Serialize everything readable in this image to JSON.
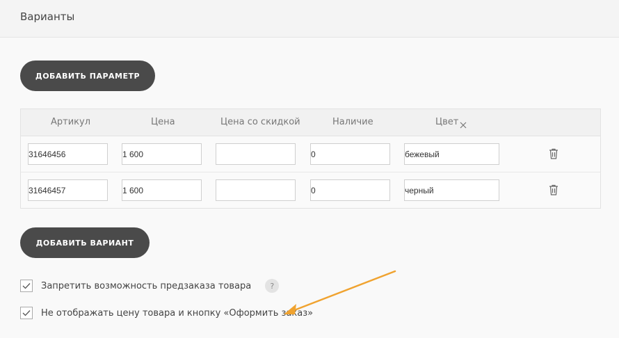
{
  "header": {
    "title": "Варианты"
  },
  "buttons": {
    "add_param": "ДОБАВИТЬ ПАРАМЕТР",
    "add_variant": "ДОБАВИТЬ ВАРИАНТ"
  },
  "table": {
    "columns": [
      "Артикул",
      "Цена",
      "Цена со скидкой",
      "Наличие",
      "Цвет"
    ],
    "color_column_remove_icon": "close-icon",
    "rows": [
      {
        "sku": "31646456",
        "price": "1 600",
        "discount_price": "",
        "stock": "0",
        "color": "бежевый"
      },
      {
        "sku": "31646457",
        "price": "1 600",
        "discount_price": "",
        "stock": "0",
        "color": "черный"
      }
    ]
  },
  "options": {
    "preorder": {
      "label": "Запретить возможность предзаказа товара",
      "checked": true,
      "help": "?"
    },
    "hide_price": {
      "label": "Не отображать цену товара и кнопку «Оформить заказ»",
      "checked": true
    }
  },
  "colors": {
    "button": "#4a4a4a",
    "arrow": "#f0a330"
  }
}
